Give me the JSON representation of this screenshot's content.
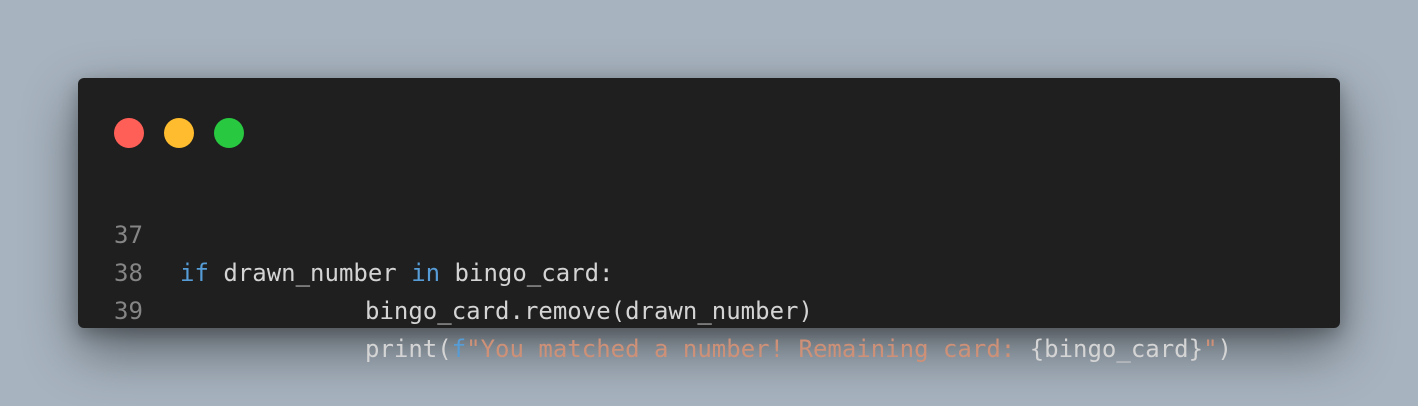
{
  "window": {
    "controls": {
      "close_color": "#ff5f57",
      "minimize_color": "#febc2e",
      "maximize_color": "#28c840"
    }
  },
  "code": {
    "lines": [
      {
        "number": "37",
        "tokens": [
          "if",
          " drawn_number ",
          "in",
          " bingo_card:"
        ]
      },
      {
        "number": "38",
        "tokens": [
          "bingo_card.remove(drawn_number)"
        ]
      },
      {
        "number": "39",
        "tokens": [
          "print(",
          "f",
          "\"You matched a number! Remaining card: ",
          "{bingo_card}",
          "\"",
          ")"
        ]
      }
    ]
  },
  "colors": {
    "background": "#a7b3bf",
    "editor_background": "#1f1f1f",
    "keyword": "#569cd6",
    "string": "#ce9178",
    "text": "#d4d4d4",
    "line_number": "#858585"
  }
}
